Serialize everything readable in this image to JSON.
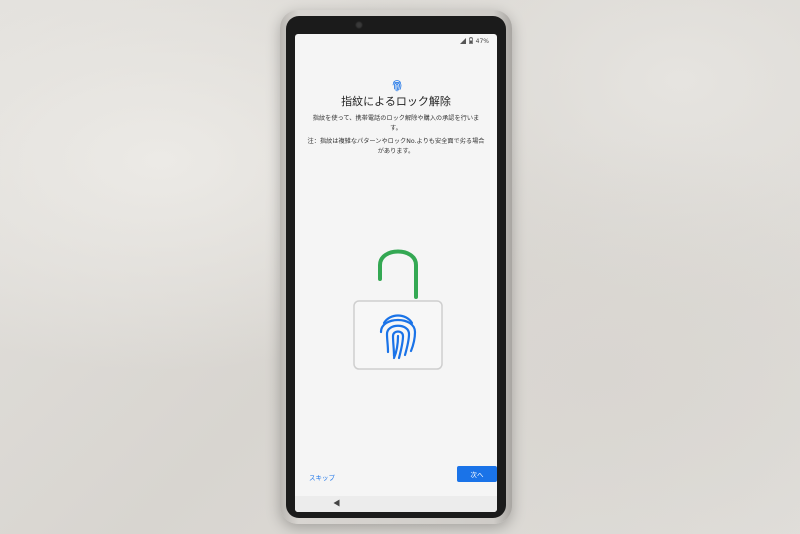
{
  "status_bar": {
    "battery": "47%",
    "icons": [
      "signal-icon",
      "battery-icon"
    ]
  },
  "header": {
    "icon": "fingerprint-icon",
    "title": "指紋によるロック解除"
  },
  "description": {
    "line": "指紋を使って、携帯電話のロック解除や購入の承認を行います。",
    "note": "注：指紋は複雑なパターンやロックNo.よりも安全面で劣る場合があります。"
  },
  "illustration": {
    "icons": [
      "unlocked-padlock-icon",
      "fingerprint-icon"
    ],
    "shackle_color": "#34a853",
    "fingerprint_color": "#1a73e8"
  },
  "buttons": {
    "skip": "スキップ",
    "next": "次へ"
  },
  "nav": {
    "back_icon": "back-triangle-icon"
  },
  "colors": {
    "accent": "#1a73e8",
    "success": "#34a853"
  }
}
